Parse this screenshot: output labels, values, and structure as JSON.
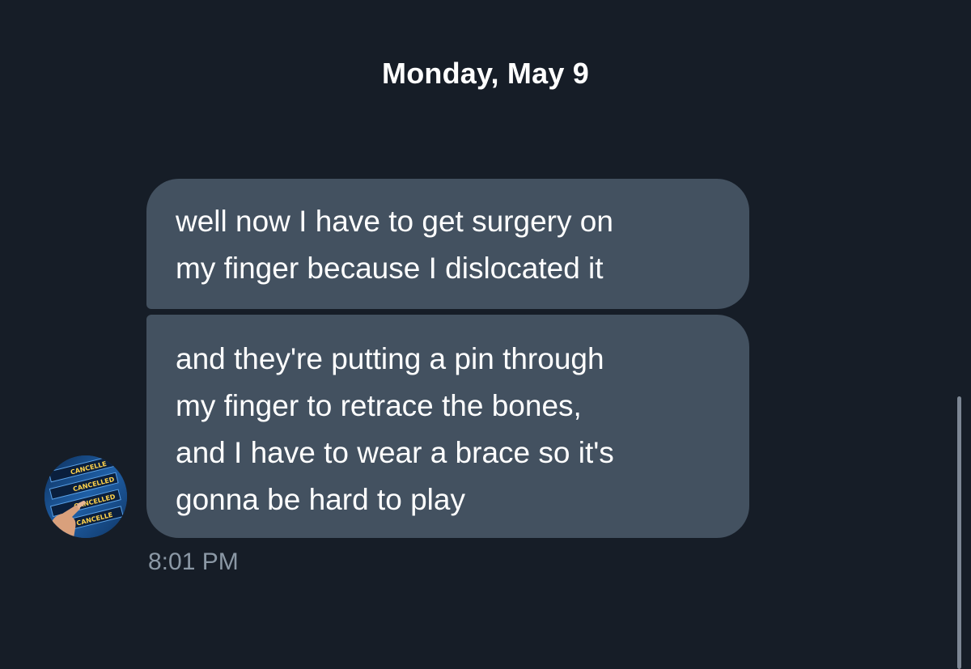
{
  "conversation": {
    "date_header": "Monday, May 9",
    "messages": [
      {
        "lines": [
          "well now I have to get surgery on",
          "my finger because I dislocated it"
        ]
      },
      {
        "lines": [
          "and they're putting a pin through",
          "my finger to retrace the bones,",
          "and I have to wear a brace so it's",
          "gonna be hard to play"
        ]
      }
    ],
    "timestamp": "8:01 PM"
  },
  "avatar": {
    "icon": "departure-board-cancelled-avatar",
    "board_labels": [
      "CANCELLE",
      "CANCELLED",
      "CANCELLED",
      "CANCELLE"
    ]
  },
  "colors": {
    "background": "#161d27",
    "bubble": "#435160",
    "text": "#ffffff",
    "timestamp": "#8b98a5"
  }
}
